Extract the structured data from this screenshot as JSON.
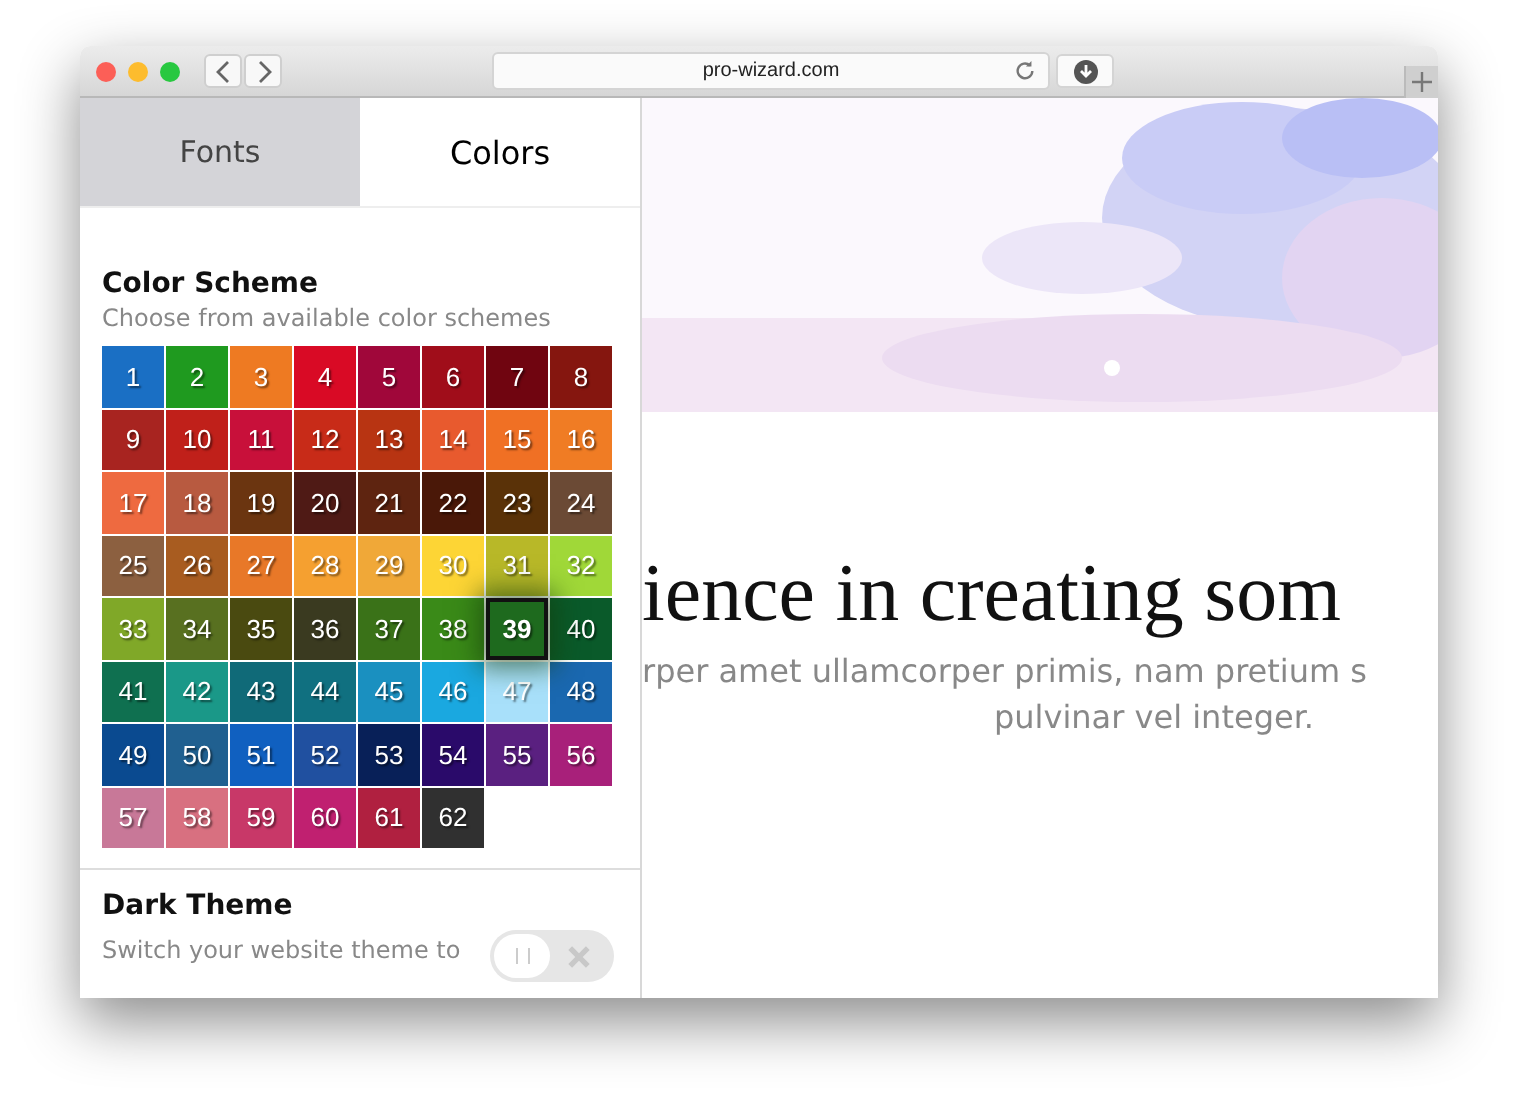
{
  "browser": {
    "address": "pro-wizard.com"
  },
  "tabs": [
    {
      "label": "Fonts",
      "selected": false
    },
    {
      "label": "Colors",
      "selected": true
    }
  ],
  "color_scheme": {
    "title": "Color Scheme",
    "subtitle": "Choose from available color schemes",
    "swatches": [
      {
        "label": "1",
        "color": "#1a6fc4",
        "selected": false
      },
      {
        "label": "2",
        "color": "#1f9a1f",
        "selected": false
      },
      {
        "label": "3",
        "color": "#ee7a22",
        "selected": false
      },
      {
        "label": "4",
        "color": "#d90a25",
        "selected": false
      },
      {
        "label": "5",
        "color": "#a0073a",
        "selected": false
      },
      {
        "label": "6",
        "color": "#a00d1a",
        "selected": false
      },
      {
        "label": "7",
        "color": "#700510",
        "selected": false
      },
      {
        "label": "8",
        "color": "#85160f",
        "selected": false
      },
      {
        "label": "9",
        "color": "#a82420",
        "selected": false
      },
      {
        "label": "10",
        "color": "#c0201a",
        "selected": false
      },
      {
        "label": "11",
        "color": "#c8103a",
        "selected": false
      },
      {
        "label": "12",
        "color": "#c82b18",
        "selected": false
      },
      {
        "label": "13",
        "color": "#b83412",
        "selected": false
      },
      {
        "label": "14",
        "color": "#e85a2e",
        "selected": false
      },
      {
        "label": "15",
        "color": "#f07024",
        "selected": false
      },
      {
        "label": "16",
        "color": "#f07c24",
        "selected": false
      },
      {
        "label": "17",
        "color": "#ee6a40",
        "selected": false
      },
      {
        "label": "18",
        "color": "#b85a40",
        "selected": false
      },
      {
        "label": "19",
        "color": "#6b3510",
        "selected": false
      },
      {
        "label": "20",
        "color": "#4f1a15",
        "selected": false
      },
      {
        "label": "21",
        "color": "#5e2410",
        "selected": false
      },
      {
        "label": "22",
        "color": "#4a1808",
        "selected": false
      },
      {
        "label": "23",
        "color": "#5a3208",
        "selected": false
      },
      {
        "label": "24",
        "color": "#6b4a35",
        "selected": false
      },
      {
        "label": "25",
        "color": "#8c6040",
        "selected": false
      },
      {
        "label": "26",
        "color": "#a85c20",
        "selected": false
      },
      {
        "label": "27",
        "color": "#e87828",
        "selected": false
      },
      {
        "label": "28",
        "color": "#f5a030",
        "selected": false
      },
      {
        "label": "29",
        "color": "#f0a838",
        "selected": false
      },
      {
        "label": "30",
        "color": "#fdd535",
        "selected": false
      },
      {
        "label": "31",
        "color": "#b8b828",
        "selected": false
      },
      {
        "label": "32",
        "color": "#a0d838",
        "selected": false
      },
      {
        "label": "33",
        "color": "#80a828",
        "selected": false
      },
      {
        "label": "34",
        "color": "#587020",
        "selected": false
      },
      {
        "label": "35",
        "color": "#4a4a10",
        "selected": false
      },
      {
        "label": "36",
        "color": "#3a3a20",
        "selected": false
      },
      {
        "label": "37",
        "color": "#3a7218",
        "selected": false
      },
      {
        "label": "38",
        "color": "#3a8a18",
        "selected": false
      },
      {
        "label": "39",
        "color": "#1e6a1e",
        "selected": true
      },
      {
        "label": "40",
        "color": "#0a5a2a",
        "selected": false
      },
      {
        "label": "41",
        "color": "#0f7050",
        "selected": false
      },
      {
        "label": "42",
        "color": "#1a9888",
        "selected": false
      },
      {
        "label": "43",
        "color": "#106a78",
        "selected": false
      },
      {
        "label": "44",
        "color": "#107080",
        "selected": false
      },
      {
        "label": "45",
        "color": "#1a90c0",
        "selected": false
      },
      {
        "label": "46",
        "color": "#1aa8e0",
        "selected": false
      },
      {
        "label": "47",
        "color": "#a8e0fa",
        "selected": false
      },
      {
        "label": "48",
        "color": "#1a68b0",
        "selected": false
      },
      {
        "label": "49",
        "color": "#0a4a90",
        "selected": false
      },
      {
        "label": "50",
        "color": "#206090",
        "selected": false
      },
      {
        "label": "51",
        "color": "#1060c0",
        "selected": false
      },
      {
        "label": "52",
        "color": "#2050a0",
        "selected": false
      },
      {
        "label": "53",
        "color": "#082058",
        "selected": false
      },
      {
        "label": "54",
        "color": "#2a0a6a",
        "selected": false
      },
      {
        "label": "55",
        "color": "#5a2080",
        "selected": false
      },
      {
        "label": "56",
        "color": "#a8207a",
        "selected": false
      },
      {
        "label": "57",
        "color": "#c87898",
        "selected": false
      },
      {
        "label": "58",
        "color": "#d87080",
        "selected": false
      },
      {
        "label": "59",
        "color": "#c83868",
        "selected": false
      },
      {
        "label": "60",
        "color": "#c02070",
        "selected": false
      },
      {
        "label": "61",
        "color": "#b02040",
        "selected": false
      },
      {
        "label": "62",
        "color": "#303030",
        "selected": false
      }
    ]
  },
  "dark_theme": {
    "title": "Dark Theme",
    "subtitle": "Switch your website theme to",
    "on": false
  },
  "preview": {
    "headline": "ience in creating som",
    "lines": [
      "rper amet ullamcorper primis, nam pretium s",
      "pulvinar vel integer."
    ]
  }
}
